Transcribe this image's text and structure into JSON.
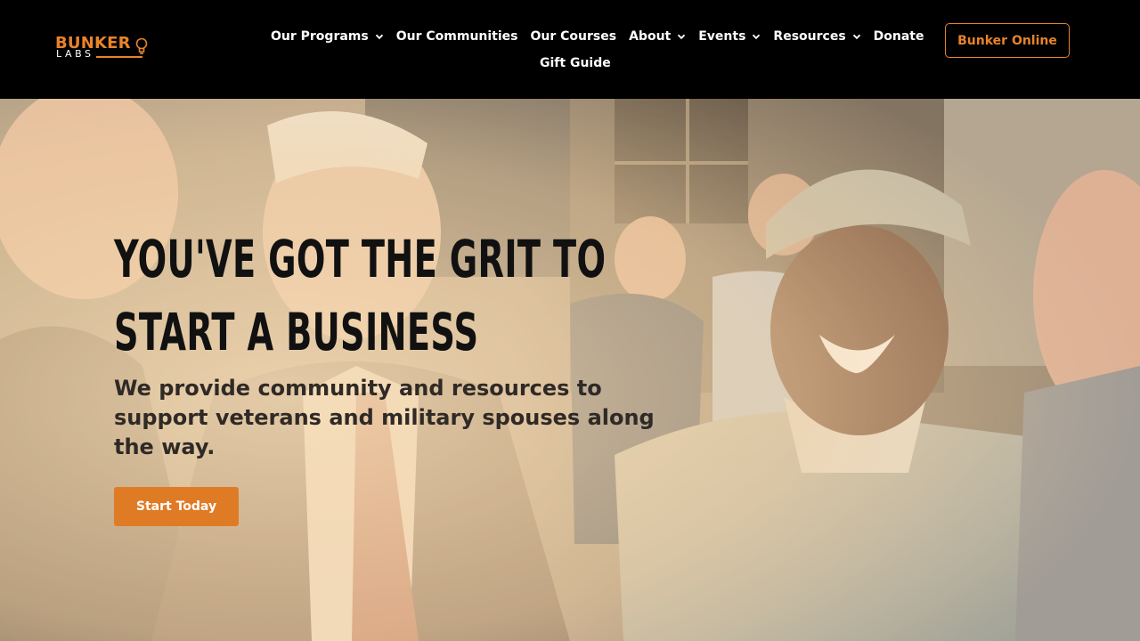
{
  "brand": {
    "logo_top": "BUNKER",
    "logo_bottom": "LABS",
    "accent_color": "#e8832a",
    "header_bg": "#000000"
  },
  "nav": {
    "items": [
      {
        "label": "Our Programs",
        "has_dropdown": true
      },
      {
        "label": "Our Communities",
        "has_dropdown": false
      },
      {
        "label": "Our Courses",
        "has_dropdown": false
      },
      {
        "label": "About",
        "has_dropdown": true
      },
      {
        "label": "Events",
        "has_dropdown": true
      },
      {
        "label": "Resources",
        "has_dropdown": true
      },
      {
        "label": "Donate",
        "has_dropdown": false
      },
      {
        "label": "Gift Guide",
        "has_dropdown": false
      }
    ],
    "cta_label": "Bunker Online"
  },
  "hero": {
    "headline_line1": "YOU'VE GOT THE GRIT TO",
    "headline_line2": "START A BUSINESS",
    "subtext": "We provide community and resources to support veterans and military spouses along the way.",
    "button_label": "Start Today",
    "button_color": "#e07b25",
    "photo_alt": "Smiling servicewoman in camouflage uniform talking with people at an event"
  }
}
